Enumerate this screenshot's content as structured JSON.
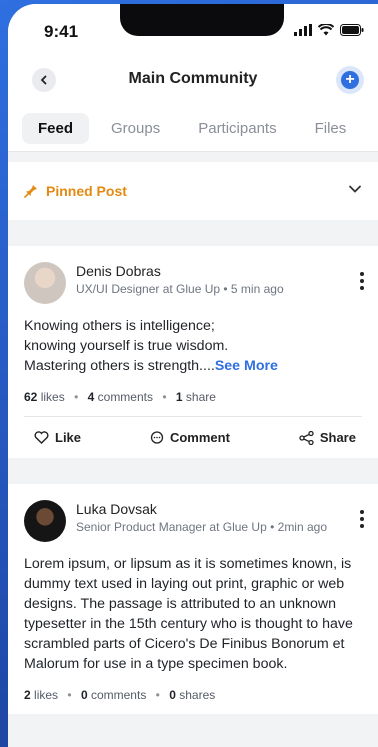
{
  "status": {
    "time": "9:41"
  },
  "nav": {
    "title": "Main Community"
  },
  "tabs": [
    {
      "label": "Feed",
      "active": true
    },
    {
      "label": "Groups",
      "active": false
    },
    {
      "label": "Participants",
      "active": false
    },
    {
      "label": "Files",
      "active": false
    }
  ],
  "pinned": {
    "label": "Pinned Post"
  },
  "posts": [
    {
      "author": "Denis Dobras",
      "subtitle": "UX/UI Designer at Glue Up • 5 min ago",
      "text_lines": [
        "Knowing others is intelligence;",
        "knowing yourself is true wisdom.",
        "Mastering others is strength...."
      ],
      "see_more": "See More",
      "likes_count": "62",
      "likes_label": "likes",
      "comments_count": "4",
      "comments_label": "comments",
      "shares_count": "1",
      "shares_label": "share"
    },
    {
      "author": "Luka Dovsak",
      "subtitle": "Senior Product Manager at Glue Up • 2min ago",
      "text": "Lorem ipsum, or lipsum as it is sometimes known, is dummy text used in laying out print, graphic or web designs. The passage is attributed to an unknown typesetter in the 15th century who is thought to have scrambled parts of Cicero's De Finibus Bonorum et Malorum for use in a type specimen book.",
      "likes_count": "2",
      "likes_label": "likes",
      "comments_count": "0",
      "comments_label": "comments",
      "shares_count": "0",
      "shares_label": "shares"
    }
  ],
  "actions": {
    "like": "Like",
    "comment": "Comment",
    "share": "Share"
  },
  "colors": {
    "accent": "#2f6fe0",
    "pinned": "#e38a13"
  }
}
